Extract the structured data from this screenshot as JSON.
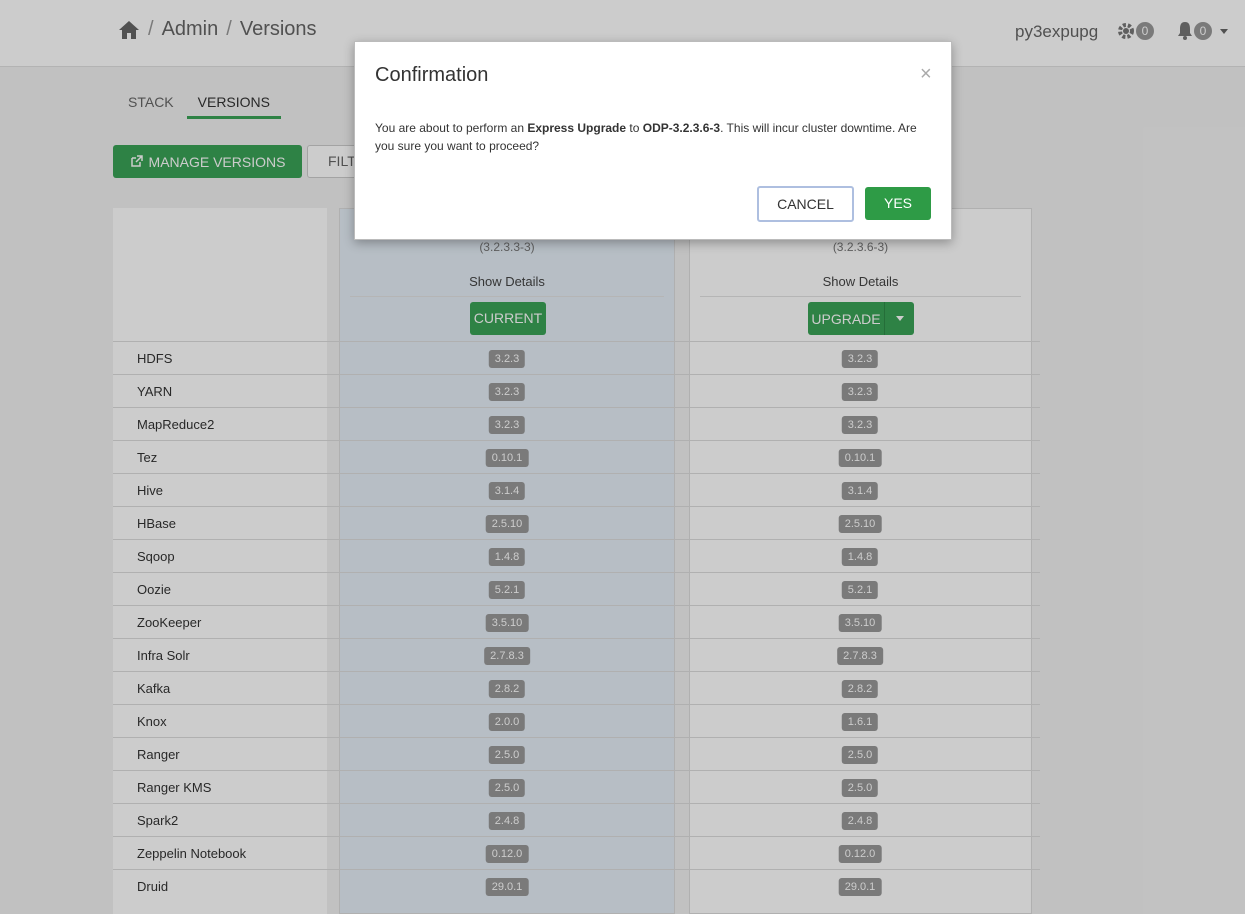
{
  "header": {
    "breadcrumb": [
      "Admin",
      "Versions"
    ],
    "user": "py3expupg",
    "ops_count": "0",
    "alerts_count": "0"
  },
  "tabs": [
    "STACK",
    "VERSIONS"
  ],
  "actions": {
    "manage_label": "MANAGE VERSIONS",
    "filter_label": "FILT"
  },
  "current_version": {
    "sub": "(3.2.3.3-3)",
    "show_details": "Show Details",
    "button": "CURRENT"
  },
  "target_version": {
    "sub": "(3.2.3.6-3)",
    "show_details": "Show Details",
    "button": "UPGRADE"
  },
  "services": [
    {
      "name": "HDFS",
      "current": "3.2.3",
      "target": "3.2.3"
    },
    {
      "name": "YARN",
      "current": "3.2.3",
      "target": "3.2.3"
    },
    {
      "name": "MapReduce2",
      "current": "3.2.3",
      "target": "3.2.3"
    },
    {
      "name": "Tez",
      "current": "0.10.1",
      "target": "0.10.1"
    },
    {
      "name": "Hive",
      "current": "3.1.4",
      "target": "3.1.4"
    },
    {
      "name": "HBase",
      "current": "2.5.10",
      "target": "2.5.10"
    },
    {
      "name": "Sqoop",
      "current": "1.4.8",
      "target": "1.4.8"
    },
    {
      "name": "Oozie",
      "current": "5.2.1",
      "target": "5.2.1"
    },
    {
      "name": "ZooKeeper",
      "current": "3.5.10",
      "target": "3.5.10"
    },
    {
      "name": "Infra Solr",
      "current": "2.7.8.3",
      "target": "2.7.8.3"
    },
    {
      "name": "Kafka",
      "current": "2.8.2",
      "target": "2.8.2"
    },
    {
      "name": "Knox",
      "current": "2.0.0",
      "target": "1.6.1"
    },
    {
      "name": "Ranger",
      "current": "2.5.0",
      "target": "2.5.0"
    },
    {
      "name": "Ranger KMS",
      "current": "2.5.0",
      "target": "2.5.0"
    },
    {
      "name": "Spark2",
      "current": "2.4.8",
      "target": "2.4.8"
    },
    {
      "name": "Zeppelin Notebook",
      "current": "0.12.0",
      "target": "0.12.0"
    },
    {
      "name": "Druid",
      "current": "29.0.1",
      "target": "29.0.1"
    }
  ],
  "modal": {
    "title": "Confirmation",
    "close": "×",
    "text_1": "You are about to perform an ",
    "bold_1": "Express Upgrade",
    "text_2": " to ",
    "bold_2": "ODP-3.2.3.6-3",
    "text_3": ". This will incur cluster downtime. Are you sure you want to proceed?",
    "cancel": "CANCEL",
    "yes": "YES"
  }
}
